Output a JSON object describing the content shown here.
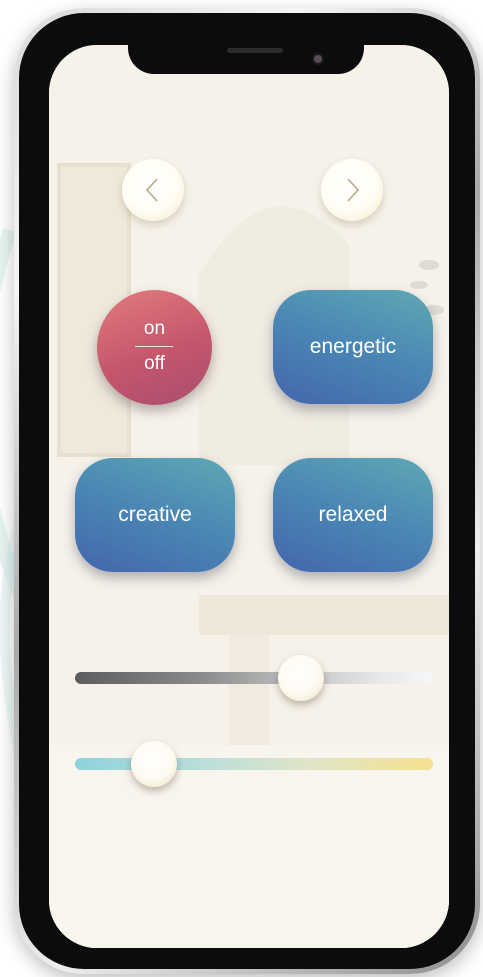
{
  "power": {
    "on_label": "on",
    "off_label": "off"
  },
  "modes": {
    "energetic": "energetic",
    "creative": "creative",
    "relaxed": "relaxed"
  },
  "nav": {
    "prev_icon": "chevron-left-icon",
    "next_icon": "chevron-right-icon"
  },
  "sliders": {
    "brightness": {
      "value_fraction": 0.63
    },
    "color_temperature": {
      "value_fraction": 0.22
    }
  },
  "colors": {
    "power_button": "#c5566c",
    "mode_button": "#4a86b4",
    "knob": "#fffdf4"
  }
}
